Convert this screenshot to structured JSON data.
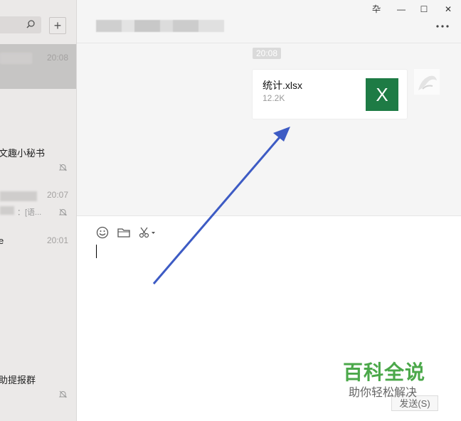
{
  "sidebar": {
    "add_label": "+",
    "chats": [
      {
        "name": "",
        "time": "20:08"
      },
      {
        "name": "文趣小秘书",
        "time": ""
      },
      {
        "name": "",
        "time": "20:07",
        "preview": "：[语..."
      },
      {
        "name": "e",
        "time": "20:01"
      },
      {
        "name": "助提报群",
        "time": ""
      }
    ]
  },
  "window": {
    "pin": "卆",
    "minimize": "—",
    "maximize": "☐",
    "close": "✕"
  },
  "messages": {
    "timestamp": "20:08",
    "file": {
      "name": "统计.xlsx",
      "size": "12.2K",
      "icon_letter": "X"
    }
  },
  "input": {
    "send_label": "发送(S)"
  },
  "watermark": {
    "title": "百科全说",
    "subtitle": "助你轻松解决"
  },
  "colors": {
    "excel_green": "#1e7b45",
    "annotation_arrow": "#3d5bc4",
    "watermark_green": "#4ba84a"
  }
}
